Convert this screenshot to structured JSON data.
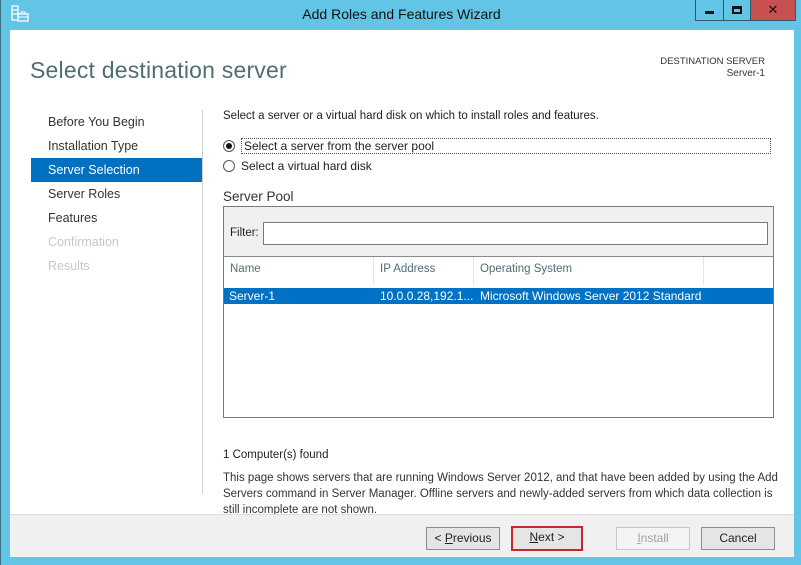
{
  "window": {
    "title": "Add Roles and Features Wizard",
    "icon": "server-manager-icon",
    "controls": {
      "minimize": "minimize-icon",
      "maximize": "maximize-icon",
      "close": "close-icon"
    }
  },
  "header": {
    "title": "Select destination server",
    "destination_label": "DESTINATION SERVER",
    "destination_value": "Server-1"
  },
  "nav": {
    "items": [
      {
        "label": "Before You Begin",
        "state": "normal"
      },
      {
        "label": "Installation Type",
        "state": "normal"
      },
      {
        "label": "Server Selection",
        "state": "active"
      },
      {
        "label": "Server Roles",
        "state": "normal"
      },
      {
        "label": "Features",
        "state": "normal"
      },
      {
        "label": "Confirmation",
        "state": "disabled"
      },
      {
        "label": "Results",
        "state": "disabled"
      }
    ]
  },
  "content": {
    "intro": "Select a server or a virtual hard disk on which to install roles and features.",
    "options": [
      {
        "label": "Select a server from the server pool",
        "selected": true
      },
      {
        "label": "Select a virtual hard disk",
        "selected": false
      }
    ],
    "pool_title": "Server Pool",
    "filter": {
      "label": "Filter:",
      "value": "",
      "placeholder": ""
    },
    "columns": [
      "Name",
      "IP Address",
      "Operating System"
    ],
    "rows": [
      {
        "name": "Server-1",
        "ip": "10.0.0.28,192.1...",
        "os": "Microsoft Windows Server 2012 Standard",
        "selected": true
      }
    ],
    "found": "1 Computer(s) found",
    "note": "This page shows servers that are running Windows Server 2012, and that have been added by using the Add Servers command in Server Manager. Offline servers and newly-added servers from which data collection is still incomplete are not shown."
  },
  "footer": {
    "previous": {
      "prefix": "< ",
      "mnemonic": "P",
      "rest": "revious"
    },
    "next": {
      "mnemonic": "N",
      "rest": "ext >"
    },
    "install": {
      "mnemonic": "I",
      "rest": "nstall",
      "enabled": false
    },
    "cancel": "Cancel"
  },
  "colors": {
    "frame": "#62c5e6",
    "selection": "#0072c6",
    "close": "#c75050",
    "highlight_border": "#c8262e"
  }
}
